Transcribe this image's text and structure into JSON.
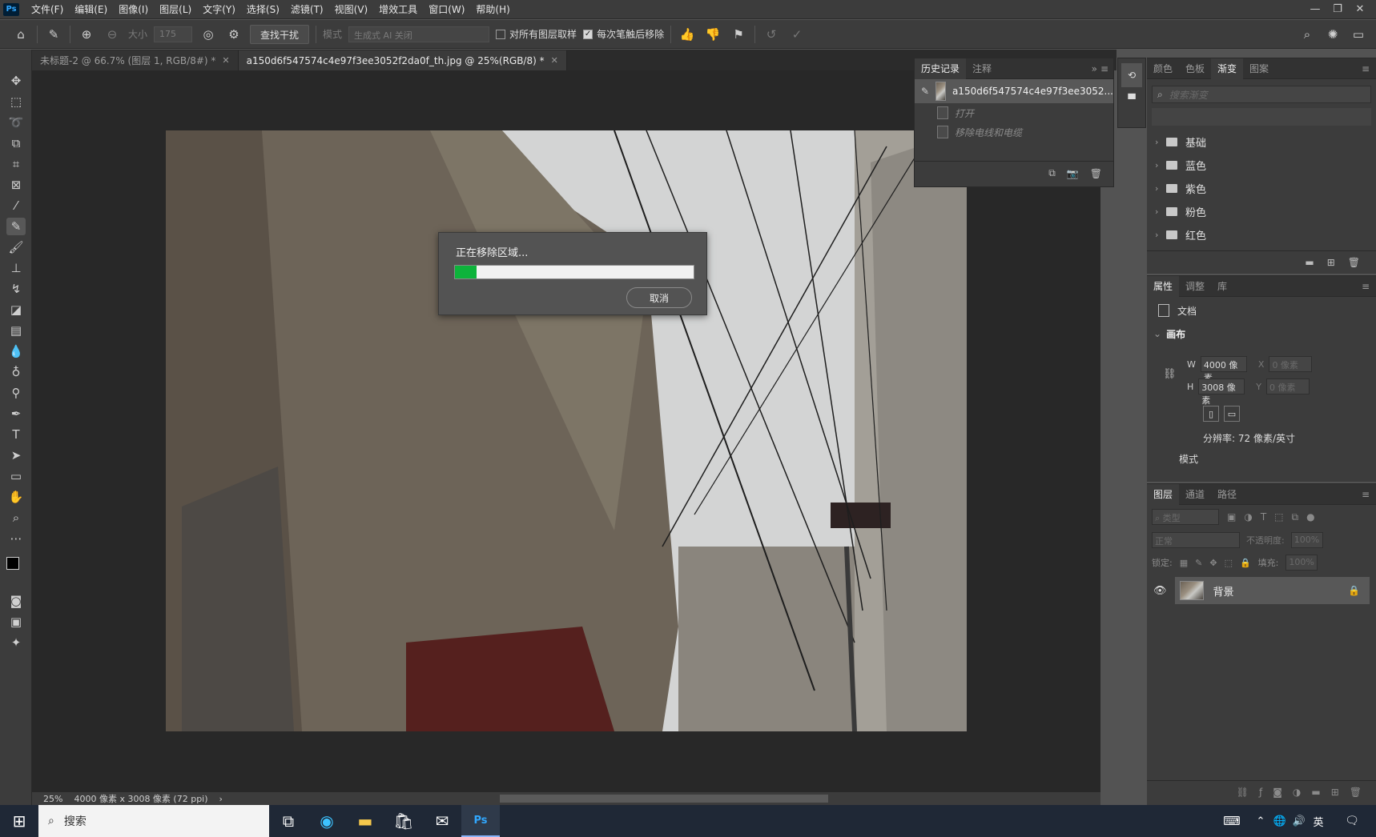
{
  "menubar": {
    "app_badge": "Ps",
    "items": [
      "文件(F)",
      "编辑(E)",
      "图像(I)",
      "图层(L)",
      "文字(Y)",
      "选择(S)",
      "滤镜(T)",
      "视图(V)",
      "增效工具",
      "窗口(W)",
      "帮助(H)"
    ],
    "window_controls": [
      "—",
      "❐",
      "✕"
    ]
  },
  "options": {
    "size_label": "大小",
    "size_value": "175",
    "find_distractions": "查找干扰",
    "mode_label": "模式",
    "mode_value": "生成式 AI 关闭",
    "sample_all_layers": "对所有图层取样",
    "remove_after_stroke": "每次笔触后移除"
  },
  "tabs": [
    {
      "label": "未标题-2 @ 66.7% (图层 1, RGB/8#) *",
      "active": false
    },
    {
      "label": "a150d6f547574c4e97f3ee3052f2da0f_th.jpg @ 25%(RGB/8) *",
      "active": true
    }
  ],
  "dialog": {
    "title": "正在移除区域...",
    "cancel_label": "取消",
    "progress_fraction": 0.09
  },
  "history": {
    "tabs": [
      "历史记录",
      "注释"
    ],
    "snapshot_name": "a150d6f547574c4e97f3ee3052...",
    "states": [
      "打开",
      "移除电线和电缆"
    ]
  },
  "gradients_panel": {
    "tabs": [
      "颜色",
      "色板",
      "渐变",
      "图案"
    ],
    "search_placeholder": "搜索渐变",
    "groups": [
      "基础",
      "蓝色",
      "紫色",
      "粉色",
      "红色"
    ]
  },
  "properties": {
    "tabs": [
      "属性",
      "调整",
      "库"
    ],
    "doc_label": "文档",
    "section": "画布",
    "w_label": "W",
    "w_value": "4000 像素",
    "h_label": "H",
    "h_value": "3008 像素",
    "x_label": "X",
    "x_value": "0 像素",
    "y_label": "Y",
    "y_value": "0 像素",
    "resolution": "分辨率: 72 像素/英寸",
    "mode_label": "模式"
  },
  "layers": {
    "tabs": [
      "图层",
      "通道",
      "路径"
    ],
    "filter_label": "类型",
    "blend_mode": "正常",
    "opacity_label": "不透明度:",
    "opacity_value": "100%",
    "lock_label": "锁定:",
    "fill_label": "填充:",
    "fill_value": "100%",
    "layer_name": "背景"
  },
  "status": {
    "zoom": "25%",
    "doc_info": "4000 像素 x 3008 像素 (72 ppi)"
  },
  "taskbar": {
    "search_label": "搜索",
    "ime": "英"
  },
  "colors": {
    "progress_green": "#0db33b",
    "ps_blue": "#31a8ff"
  }
}
